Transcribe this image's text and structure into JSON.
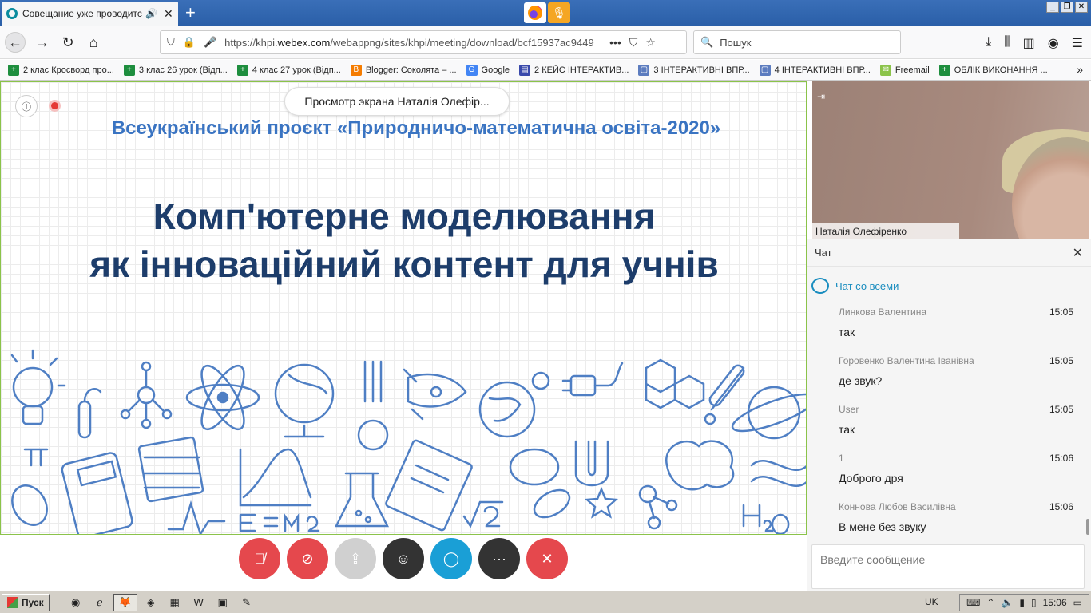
{
  "browser": {
    "tab_title": "Совещание уже проводится...",
    "url_prefix": "https://khpi.",
    "url_domain": "webex.com",
    "url_path": "/webappng/sites/khpi/meeting/download/bcf15937ac9449",
    "search_placeholder": "Пошук",
    "bookmarks": [
      {
        "label": "2 клас Кросворд про...",
        "icon": "sheets-icon",
        "color": "#1e8e3e"
      },
      {
        "label": "3 клас 26 урок (Відп...",
        "icon": "sheets-icon",
        "color": "#1e8e3e"
      },
      {
        "label": "4 клас 27 урок (Відп...",
        "icon": "sheets-icon",
        "color": "#1e8e3e"
      },
      {
        "label": "Blogger: Соколята – ...",
        "icon": "blogger-icon",
        "color": "#f57c00"
      },
      {
        "label": "Google",
        "icon": "google-icon",
        "color": "#4285f4"
      },
      {
        "label": "2 КЕЙС ІНТЕРАКТИВ...",
        "icon": "forms-icon",
        "color": "#3949ab"
      },
      {
        "label": "3 ІНТЕРАКТИВНІ ВПР...",
        "icon": "doc-icon",
        "color": "#5c7cbf"
      },
      {
        "label": "4 ІНТЕРАКТИВНІ ВПР...",
        "icon": "doc-icon",
        "color": "#5c7cbf"
      },
      {
        "label": "Freemail",
        "icon": "mail-icon",
        "color": "#8bc34a"
      },
      {
        "label": "ОБЛІК ВИКОНАННЯ ...",
        "icon": "sheets-icon",
        "color": "#1e8e3e"
      }
    ]
  },
  "meeting": {
    "share_label": "Просмотр экрана Наталія Олефір...",
    "slide_subtitle": "Всеукраїнський проєкт «Природничо-математична освіта-2020»",
    "slide_title_line1": "Комп'ютерне моделювання",
    "slide_title_line2": "як інноваційний контент для учнів",
    "video_name": "Наталія Олефіренко"
  },
  "chat": {
    "title": "Чат",
    "target": "Чат со всеми",
    "input_placeholder": "Введите сообщение",
    "messages": [
      {
        "sender": "Линкова Валентина",
        "time": "15:05",
        "text": "так"
      },
      {
        "sender": "Горовенко Валентина Іванівна",
        "time": "15:05",
        "text": "де звук?"
      },
      {
        "sender": "User",
        "time": "15:05",
        "text": "так"
      },
      {
        "sender": "1",
        "time": "15:06",
        "text": "Доброго дря"
      },
      {
        "sender": "Коннова Любов Василівна",
        "time": "15:06",
        "text": "В мене без звуку"
      }
    ]
  },
  "controls": {
    "mute_color": "#e5484d",
    "video_color": "#e5484d",
    "share_color": "#d0d0d0",
    "participants_color": "#333333",
    "chat_color": "#1a9fd6",
    "more_color": "#333333",
    "leave_color": "#e5484d"
  },
  "taskbar": {
    "start_label": "Пуск",
    "lang": "UK",
    "clock": "15:06"
  }
}
